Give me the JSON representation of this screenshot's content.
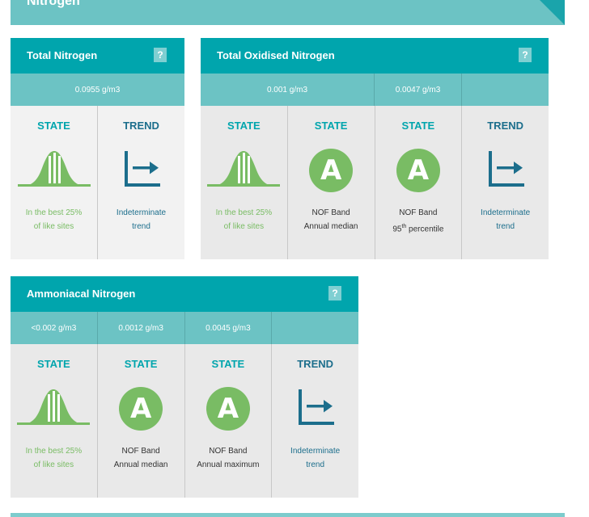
{
  "section": {
    "title": "Nitrogen"
  },
  "panels": {
    "tn": {
      "title": "Total Nitrogen",
      "help": "?",
      "values": [
        "0.0955 g/m3"
      ],
      "cells": [
        {
          "heading": "STATE",
          "kind": "state",
          "icon": "bell-curve-icon",
          "line1": "In the best 25%",
          "line2": "of like sites"
        },
        {
          "heading": "TREND",
          "kind": "trend",
          "icon": "trend-indeterminate-icon",
          "line1": "Indeterminate",
          "line2": "trend"
        }
      ]
    },
    "ton": {
      "title": "Total Oxidised Nitrogen",
      "help": "?",
      "values": [
        "0.001 g/m3",
        "0.0047 g/m3",
        ""
      ],
      "cells": [
        {
          "heading": "STATE",
          "kind": "state",
          "icon": "bell-curve-icon",
          "line1": "In the best 25%",
          "line2": "of like sites"
        },
        {
          "heading": "STATE",
          "kind": "state",
          "icon": "grade-a-icon",
          "grade": "A",
          "line1": "NOF Band",
          "line2": "Annual median"
        },
        {
          "heading": "STATE",
          "kind": "state",
          "icon": "grade-a-icon",
          "grade": "A",
          "line1": "NOF Band",
          "line2_pre": "95",
          "line2_sup": "th",
          "line2_post": " percentile"
        },
        {
          "heading": "TREND",
          "kind": "trend",
          "icon": "trend-indeterminate-icon",
          "line1": "Indeterminate",
          "line2": "trend"
        }
      ]
    },
    "an": {
      "title": "Ammoniacal Nitrogen",
      "help": "?",
      "values": [
        "<0.002 g/m3",
        "0.0012 g/m3",
        "0.0045 g/m3",
        ""
      ],
      "cells": [
        {
          "heading": "STATE",
          "kind": "state",
          "icon": "bell-curve-icon",
          "line1": "In the best 25%",
          "line2": "of like sites"
        },
        {
          "heading": "STATE",
          "kind": "state",
          "icon": "grade-a-icon",
          "grade": "A",
          "line1": "NOF Band",
          "line2": "Annual median"
        },
        {
          "heading": "STATE",
          "kind": "state",
          "icon": "grade-a-icon",
          "grade": "A",
          "line1": "NOF Band",
          "line2": "Annual maximum"
        },
        {
          "heading": "TREND",
          "kind": "trend",
          "icon": "trend-indeterminate-icon",
          "line1": "Indeterminate",
          "line2": "trend"
        }
      ]
    }
  },
  "colors": {
    "teal": "#00a5ad",
    "teal_light": "#6cc3c4",
    "green": "#79bc64",
    "trend_blue": "#1c6e8c",
    "cell_bg": "#e9e9e9"
  }
}
